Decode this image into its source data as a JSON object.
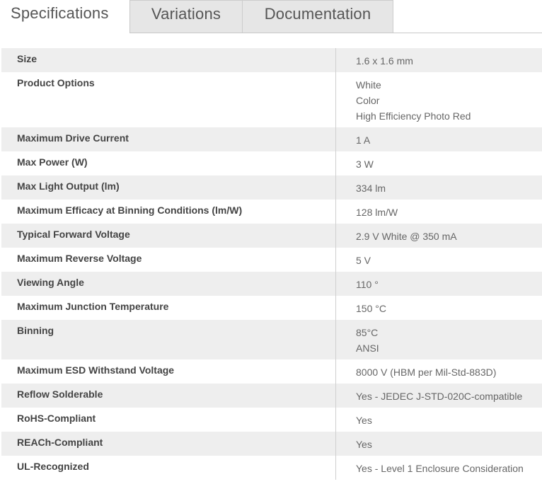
{
  "tabs": [
    {
      "label": "Specifications",
      "active": true
    },
    {
      "label": "Variations",
      "active": false
    },
    {
      "label": "Documentation",
      "active": false
    }
  ],
  "specs": [
    {
      "label": "Size",
      "values": [
        "1.6 x 1.6 mm"
      ]
    },
    {
      "label": "Product Options",
      "values": [
        "White",
        "Color",
        "High Efficiency Photo Red"
      ]
    },
    {
      "label": "Maximum Drive Current",
      "values": [
        "1 A"
      ]
    },
    {
      "label": "Max Power (W)",
      "values": [
        "3 W"
      ]
    },
    {
      "label": "Max Light Output (lm)",
      "values": [
        "334 lm"
      ]
    },
    {
      "label": "Maximum Efficacy at Binning Conditions (lm/W)",
      "values": [
        "128 lm/W"
      ]
    },
    {
      "label": "Typical Forward Voltage",
      "values": [
        "2.9 V White @ 350 mA"
      ]
    },
    {
      "label": "Maximum Reverse Voltage",
      "values": [
        "5 V"
      ]
    },
    {
      "label": "Viewing Angle",
      "values": [
        "110 °"
      ]
    },
    {
      "label": "Maximum Junction Temperature",
      "values": [
        "150 °C"
      ]
    },
    {
      "label": "Binning",
      "values": [
        "85°C",
        "ANSI"
      ]
    },
    {
      "label": "Maximum ESD Withstand Voltage",
      "values": [
        "8000 V (HBM per Mil-Std-883D)"
      ]
    },
    {
      "label": "Reflow Solderable",
      "values": [
        "Yes - JEDEC J-STD-020C-compatible"
      ]
    },
    {
      "label": "RoHS-Compliant",
      "values": [
        "Yes"
      ]
    },
    {
      "label": "REACh-Compliant",
      "values": [
        "Yes"
      ]
    },
    {
      "label": "UL-Recognized",
      "values": [
        "Yes - Level 1 Enclosure Consideration"
      ]
    }
  ]
}
